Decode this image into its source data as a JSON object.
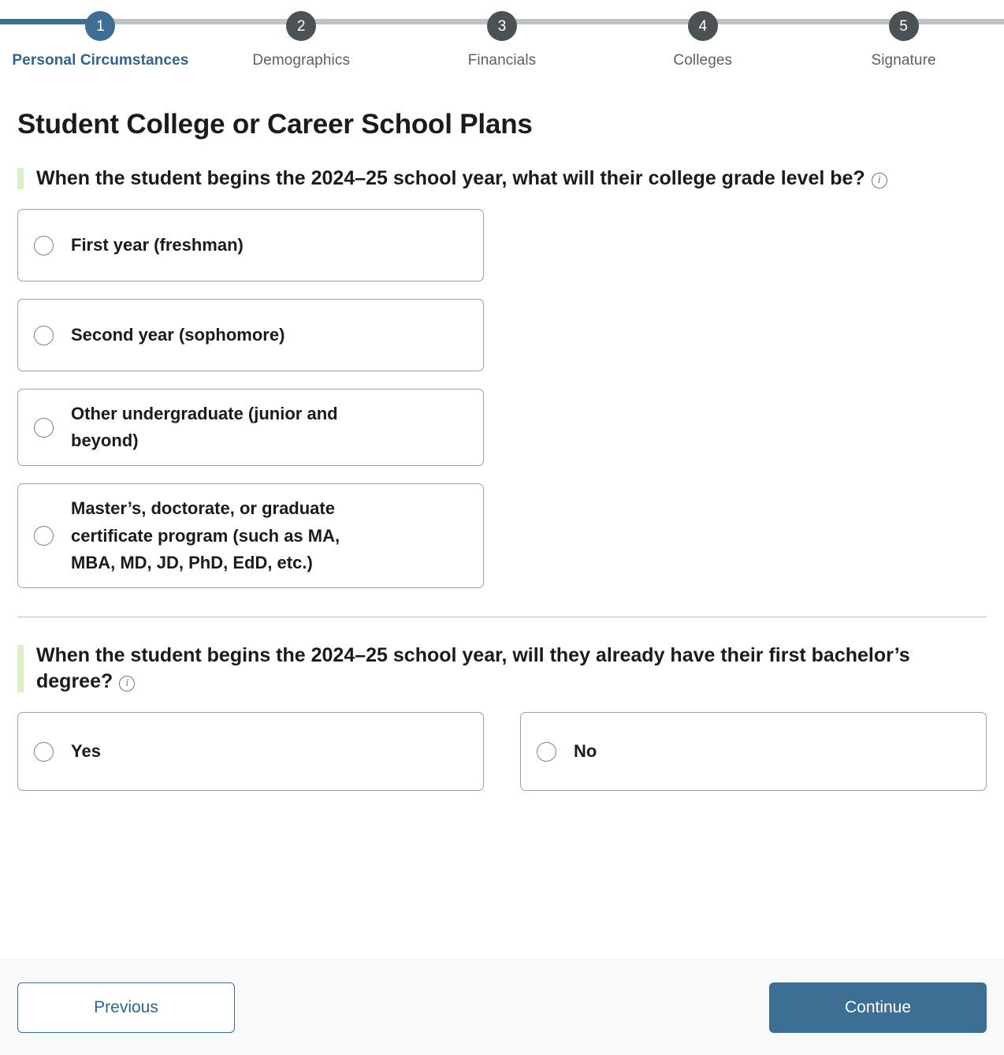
{
  "stepper": {
    "steps": [
      {
        "number": "1",
        "label": "Personal Circumstances",
        "state": "active"
      },
      {
        "number": "2",
        "label": "Demographics",
        "state": "upcoming"
      },
      {
        "number": "3",
        "label": "Financials",
        "state": "upcoming"
      },
      {
        "number": "4",
        "label": "Colleges",
        "state": "upcoming"
      },
      {
        "number": "5",
        "label": "Signature",
        "state": "upcoming"
      }
    ],
    "active_color": "#3d6e93",
    "inactive_color": "#4b5255",
    "track_color": "#bfc3c4"
  },
  "page": {
    "title": "Student College or Career School Plans"
  },
  "question1": {
    "text": "When the student begins the 2024–25 school year, what will their college grade level be?",
    "info_icon": "info-icon",
    "accent_color": "#d9f0c8",
    "options": [
      {
        "label": "First year (freshman)",
        "selected": false
      },
      {
        "label": "Second year (sophomore)",
        "selected": false
      },
      {
        "label": "Other undergraduate (junior and beyond)",
        "selected": false
      },
      {
        "label": "Master’s, doctorate, or graduate certificate program (such as MA, MBA, MD, JD, PhD, EdD, etc.)",
        "selected": false
      }
    ]
  },
  "question2": {
    "text": "When the student begins the 2024–25 school year, will they already have their first bachelor’s degree?",
    "info_icon": "info-icon",
    "accent_color": "#d9f0c8",
    "options": [
      {
        "label": "Yes",
        "selected": false
      },
      {
        "label": "No",
        "selected": false
      }
    ]
  },
  "footer": {
    "previous_label": "Previous",
    "continue_label": "Continue",
    "primary_color": "#3d6e93"
  }
}
